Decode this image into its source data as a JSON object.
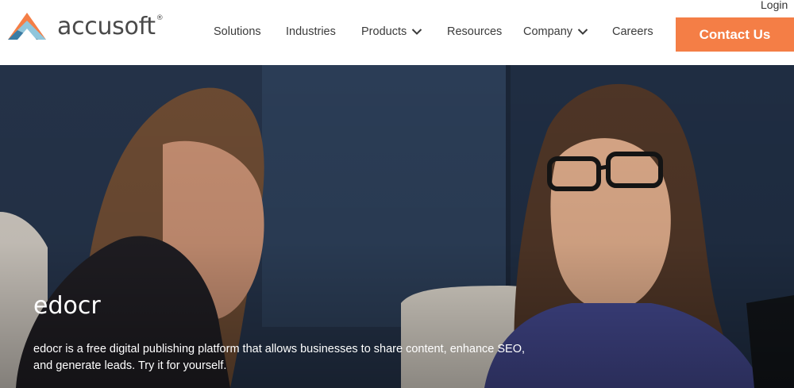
{
  "header": {
    "logo_text": "accusoft",
    "logo_reg": "®",
    "login_label": "Login",
    "contact_label": "Contact Us",
    "brand_color": "#f47e46"
  },
  "nav": {
    "items": [
      {
        "label": "Solutions"
      },
      {
        "label": "Industries"
      },
      {
        "label": "Products",
        "dropdown": true
      },
      {
        "label": "Resources"
      },
      {
        "label": "Company",
        "dropdown": true
      },
      {
        "label": "Careers"
      }
    ]
  },
  "hero": {
    "title": "edocr",
    "description": "edocr is a free digital publishing platform that allows businesses to share content, enhance SEO, and generate leads. Try it for yourself."
  }
}
